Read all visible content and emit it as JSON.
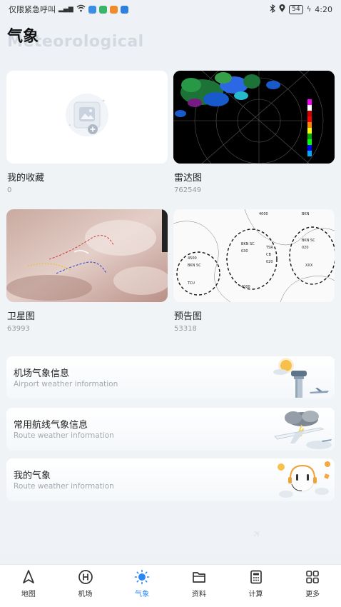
{
  "status_bar": {
    "carrier": "仅限紧急呼叫",
    "battery": "54",
    "time": "4:20"
  },
  "header": {
    "title": "气象",
    "subtitle": "Meteorological"
  },
  "grid": [
    {
      "label": "我的收藏",
      "count": "0"
    },
    {
      "label": "雷达图",
      "count": "762549"
    },
    {
      "label": "卫星图",
      "count": "63993"
    },
    {
      "label": "预告图",
      "count": "53318"
    }
  ],
  "info_cards": [
    {
      "title": "机场气象信息",
      "subtitle": "Airport weather information",
      "icon": "airport-tower-icon"
    },
    {
      "title": "常用航线气象信息",
      "subtitle": "Route weather information",
      "icon": "airplane-cloud-icon"
    },
    {
      "title": "我的气象",
      "subtitle": "Route weather information",
      "icon": "assistant-avatar-icon"
    }
  ],
  "nav": [
    {
      "label": "地图",
      "icon": "navigation-arrow-icon"
    },
    {
      "label": "机场",
      "icon": "helipad-icon"
    },
    {
      "label": "气象",
      "icon": "sun-icon",
      "active": true
    },
    {
      "label": "资料",
      "icon": "folder-icon"
    },
    {
      "label": "计算",
      "icon": "calculator-icon"
    },
    {
      "label": "更多",
      "icon": "grid-more-icon"
    }
  ],
  "colors": {
    "accent": "#2a86f5",
    "background": "#eef2f6"
  }
}
